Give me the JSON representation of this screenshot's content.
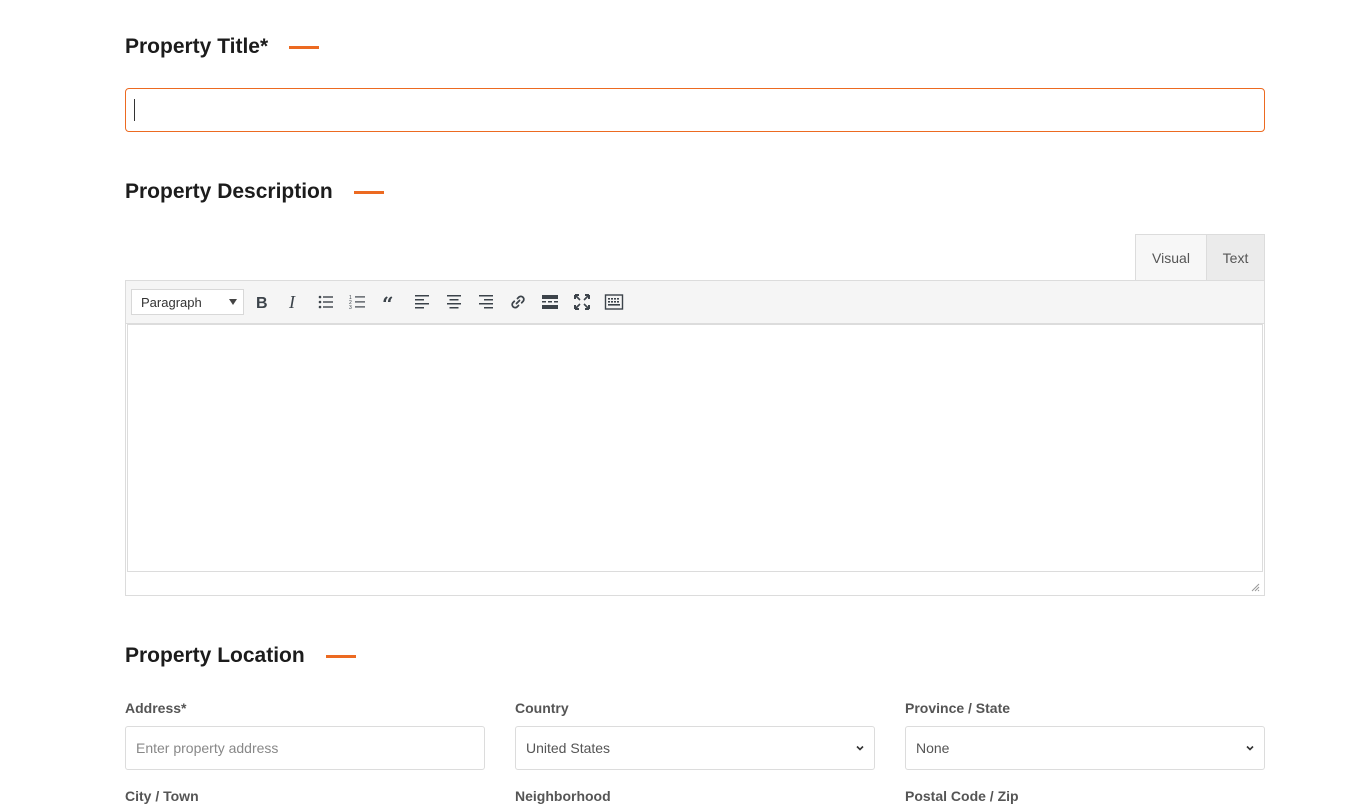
{
  "title_section": {
    "heading": "Property Title*",
    "input_value": ""
  },
  "description_section": {
    "heading": "Property Description",
    "tabs": {
      "visual": "Visual",
      "text": "Text"
    },
    "format_select": "Paragraph",
    "toolbar_icons": [
      "bold-icon",
      "italic-icon",
      "bullet-list-icon",
      "numbered-list-icon",
      "blockquote-icon",
      "align-left-icon",
      "align-center-icon",
      "align-right-icon",
      "link-icon",
      "read-more-icon",
      "fullscreen-icon",
      "toolbar-toggle-icon"
    ]
  },
  "location_section": {
    "heading": "Property Location",
    "address_label": "Address*",
    "address_placeholder": "Enter property address",
    "country_label": "Country",
    "country_value": "United States",
    "state_label": "Province / State",
    "state_value": "None",
    "city_label": "City / Town",
    "neighborhood_label": "Neighborhood",
    "postal_label": "Postal Code / Zip"
  },
  "colors": {
    "accent": "#ec6a21",
    "border": "#dcdcdc"
  }
}
